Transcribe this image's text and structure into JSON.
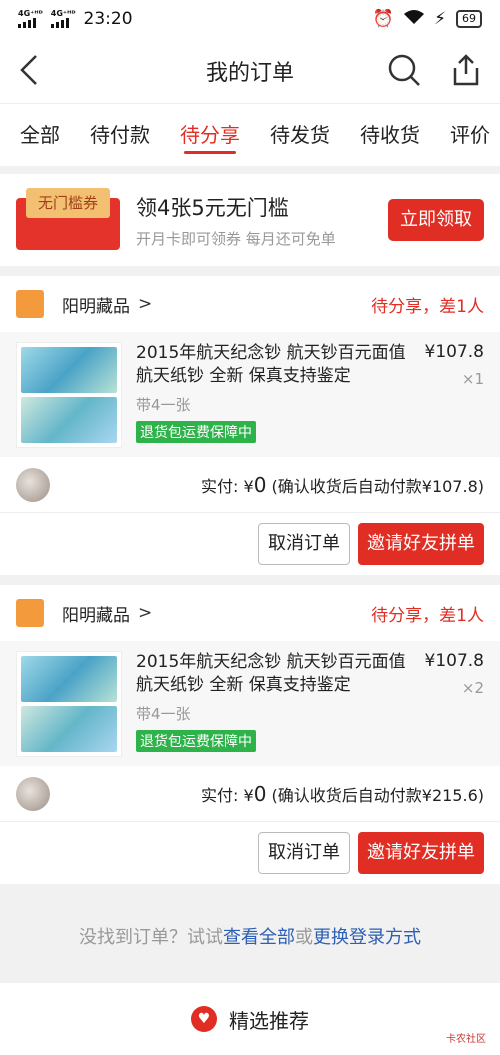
{
  "status_bar": {
    "network1": "4G⁺ᴴᴰ",
    "network2": "4G⁺ᴴᴰ",
    "time": "23:20",
    "battery": "69"
  },
  "nav": {
    "title": "我的订单"
  },
  "tabs": [
    {
      "label": "全部",
      "active": false
    },
    {
      "label": "待付款",
      "active": false
    },
    {
      "label": "待分享",
      "active": true
    },
    {
      "label": "待发货",
      "active": false
    },
    {
      "label": "待收货",
      "active": false
    },
    {
      "label": "评价",
      "active": false
    }
  ],
  "coupon": {
    "ticket_label": "无门槛券",
    "title": "领4张5元无门槛",
    "subtitle": "开月卡即可领券 每月还可免单",
    "button": "立即领取"
  },
  "orders": [
    {
      "shop_name": "阳明藏品",
      "shop_arrow": ">",
      "status": "待分享，差1人",
      "item_title": "2015年航天纪念钞 航天钞百元面值 航天纸钞 全新 保真支持鉴定",
      "item_spec": "带4一张",
      "item_tag": "退货包运费保障中",
      "price": "¥107.8",
      "qty": "×1",
      "pay_label": "实付: ¥",
      "pay_amount": "0",
      "pay_note": "(确认收货后自动付款¥107.8)",
      "cancel_button": "取消订单",
      "invite_button": "邀请好友拼单"
    },
    {
      "shop_name": "阳明藏品",
      "shop_arrow": ">",
      "status": "待分享，差1人",
      "item_title": "2015年航天纪念钞 航天钞百元面值 航天纸钞 全新 保真支持鉴定",
      "item_spec": "带4一张",
      "item_tag": "退货包运费保障中",
      "price": "¥107.8",
      "qty": "×2",
      "pay_label": "实付: ¥",
      "pay_amount": "0",
      "pay_note": "(确认收货后自动付款¥215.6)",
      "cancel_button": "取消订单",
      "invite_button": "邀请好友拼单"
    }
  ],
  "not_found": {
    "text": "没找到订单？试试",
    "link1": "查看全部",
    "or": "或",
    "link2": "更换登录方式"
  },
  "recommend": {
    "label": "精选推荐"
  },
  "watermark": "卡农社区",
  "colors": {
    "accent": "#e02e24",
    "link": "#2c5fb5",
    "tag_green": "#2eb24a"
  }
}
